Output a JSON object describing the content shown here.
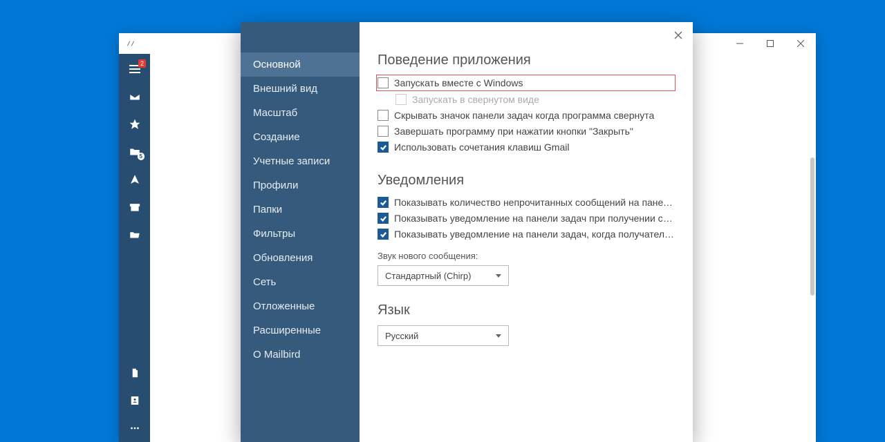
{
  "sidebar": {
    "badge": "2",
    "badge_folder": "5"
  },
  "titlebar": {
    "logo_alt": "app-logo"
  },
  "settings": {
    "nav": [
      "Основной",
      "Внешний вид",
      "Масштаб",
      "Создание",
      "Учетные записи",
      "Профили",
      "Папки",
      "Фильтры",
      "Обновления",
      "Сеть",
      "Отложенные",
      "Расширенные",
      "О Mailbird"
    ],
    "active_nav_index": 0,
    "section_behavior": "Поведение приложения",
    "opt_launch_with_windows": "Запускать вместе с Windows",
    "opt_launch_minimized": "Запускать в свернутом виде",
    "opt_hide_tray": "Скрывать значок панели задач когда программа свернута",
    "opt_close_exits": "Завершать программу при нажатии кнопки \"Закрыть\"",
    "opt_gmail_shortcuts": "Использовать сочетания клавиш Gmail",
    "section_notifications": "Уведомления",
    "opt_show_unread_count": "Показывать количество непрочитанных сообщений на панели задач",
    "opt_show_toast_receive": "Показывать уведомление на панели задач при получении сообщения",
    "opt_show_toast_open": "Показывать уведомление на панели задач, когда получатель открывае...",
    "field_sound": "Звук нового сообщения:",
    "select_sound_value": "Стандартный (Chirp)",
    "section_language": "Язык",
    "select_language_value": "Русский"
  }
}
